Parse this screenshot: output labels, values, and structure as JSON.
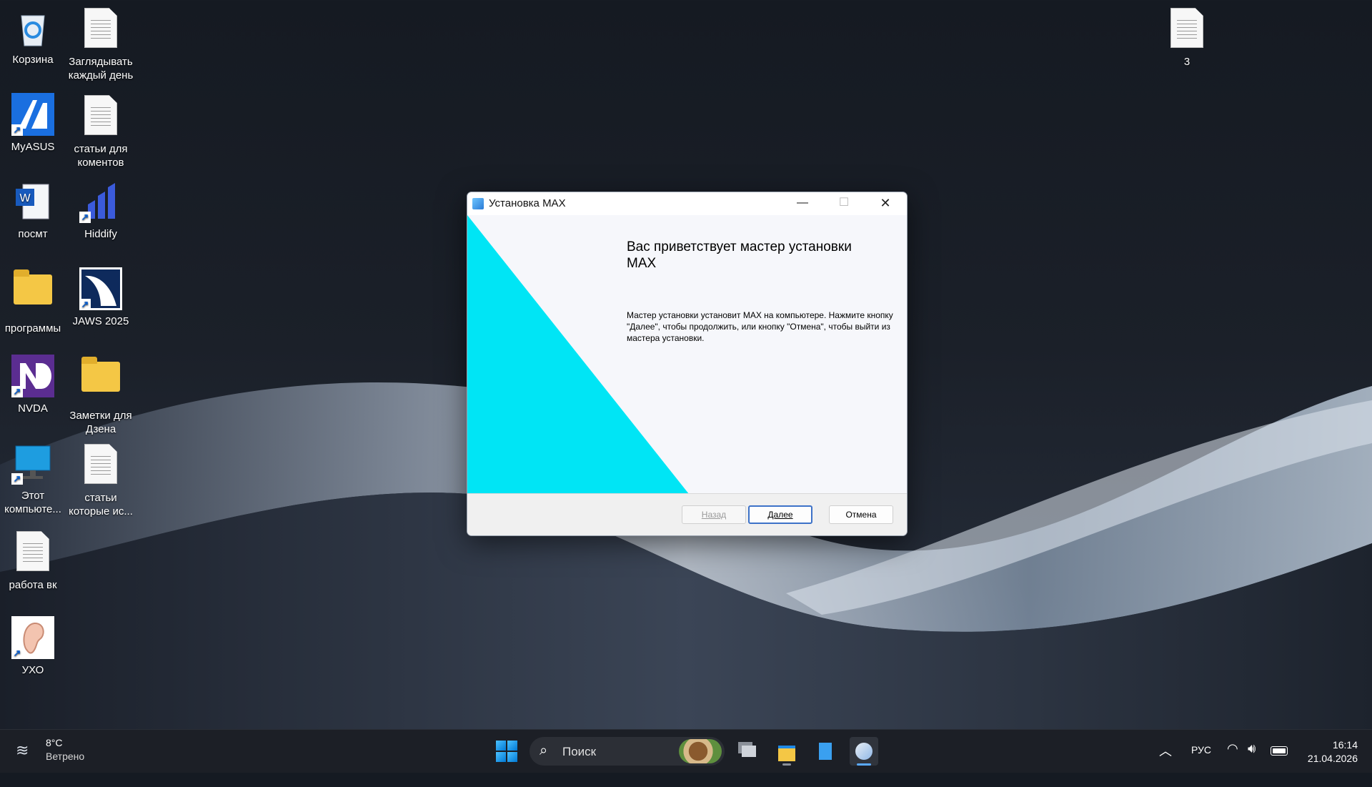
{
  "desktop": {
    "icons": [
      {
        "label": "Корзина",
        "icon": "recycle-bin-icon"
      },
      {
        "label": "Заглядывать каждый день",
        "icon": "text-file-icon"
      },
      {
        "label": "MyASUS",
        "icon": "myasus-icon"
      },
      {
        "label": "статьи для коментов",
        "icon": "text-file-icon"
      },
      {
        "label": "посмт",
        "icon": "word-document-icon"
      },
      {
        "label": "Hiddify",
        "icon": "hiddify-icon"
      },
      {
        "label": "программы",
        "icon": "folder-icon"
      },
      {
        "label": "JAWS 2025",
        "icon": "jaws-icon"
      },
      {
        "label": "NVDA",
        "icon": "nvda-icon"
      },
      {
        "label": "Заметки для Дзена",
        "icon": "folder-icon"
      },
      {
        "label": "Этот компьюте...",
        "icon": "this-pc-icon"
      },
      {
        "label": "статьи которые ис...",
        "icon": "text-file-icon"
      },
      {
        "label": "работа вк",
        "icon": "text-file-icon"
      },
      {
        "label": "УХО",
        "icon": "ear-icon"
      },
      {
        "label": "3",
        "icon": "text-file-icon"
      }
    ]
  },
  "dialog": {
    "title": "Установка MAX",
    "minimize_glyph": "—",
    "maximize_glyph": "☐",
    "close_glyph": "✕",
    "banner_color": "#00e5f5",
    "welcome_title": "Вас приветствует мастер установки MAX",
    "welcome_text": "Мастер установки установит MAX на компьютере. Нажмите кнопку \"Далее\", чтобы продолжить, или кнопку \"Отмена\", чтобы выйти из мастера установки.",
    "buttons": {
      "back": "Назад",
      "next": "Далее",
      "cancel": "Отмена"
    }
  },
  "taskbar": {
    "weather": {
      "temp": "8°C",
      "condition": "Ветрено"
    },
    "search_placeholder": "Поиск",
    "language": "РУС",
    "time": "16:14",
    "date": "21.04.2026"
  }
}
